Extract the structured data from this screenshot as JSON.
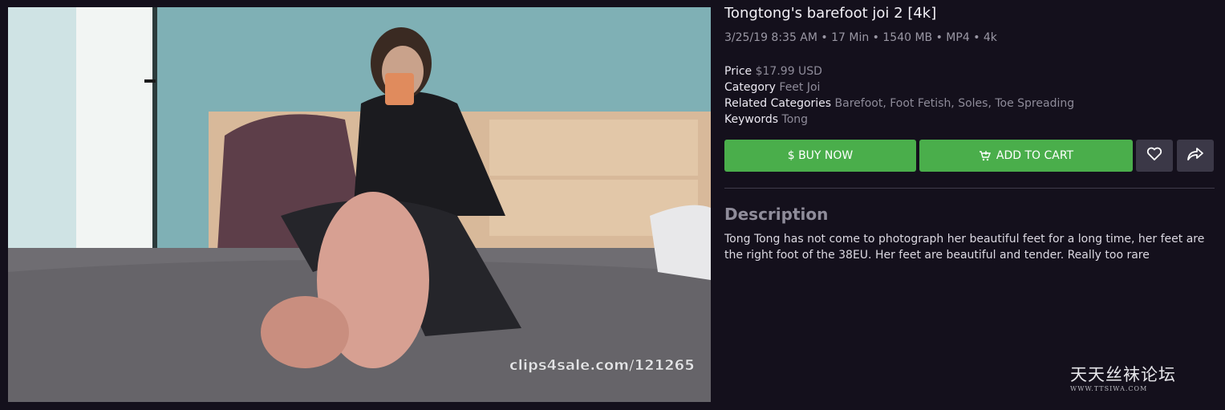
{
  "preview": {
    "watermark": "clips4sale.com/121265"
  },
  "product": {
    "title": "Tongtong's barefoot joi 2 [4k]",
    "meta": "3/25/19 8:35 AM • 17 Min • 1540 MB • MP4 • 4k",
    "price_label": "Price",
    "price_value": "$17.99 USD",
    "category_label": "Category",
    "category_value": "Feet Joi",
    "related_label": "Related Categories",
    "related_value": "Barefoot, Foot Fetish, Soles, Toe Spreading",
    "keywords_label": "Keywords",
    "keywords_value": "Tong"
  },
  "actions": {
    "buy_label": "$ BUY NOW",
    "cart_label": "ADD TO CART",
    "favorite_icon": "heart-icon",
    "share_icon": "share-icon",
    "cart_icon": "cart-plus-icon",
    "accent_color": "#4aae4b"
  },
  "description": {
    "heading": "Description",
    "text": "Tong Tong has not come to photograph her beautiful feet for a long time, her feet are the right foot of the 38EU. Her feet are beautiful and tender. Really too rare"
  },
  "site_logo": {
    "name": "天天丝袜论坛",
    "url": "WWW.TTSIWA.COM"
  }
}
